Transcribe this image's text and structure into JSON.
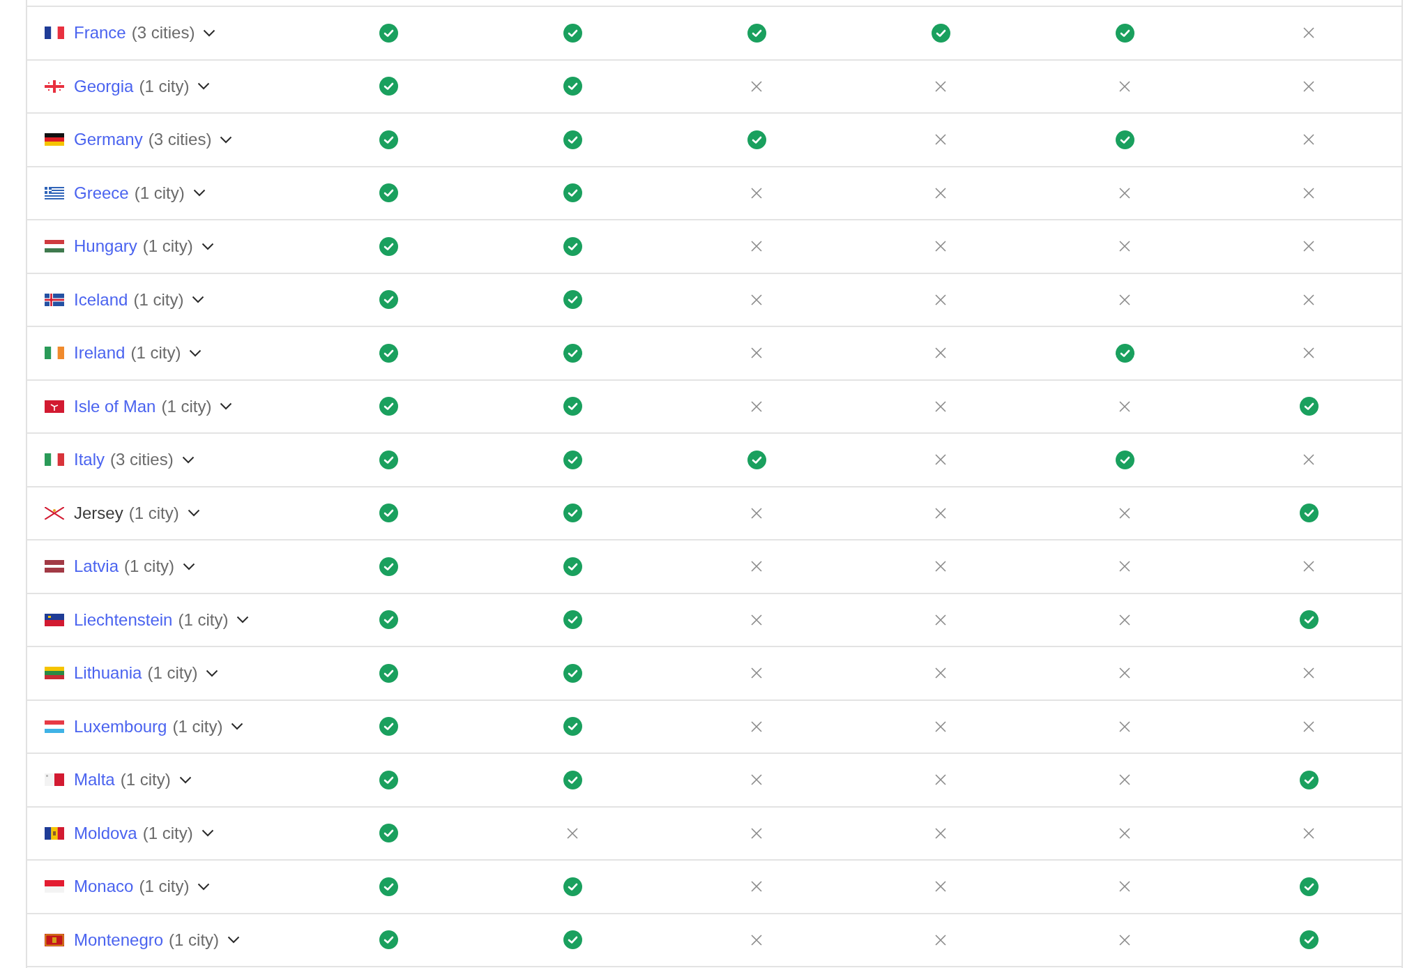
{
  "rows": [
    {
      "kind": "fr",
      "name": "France",
      "link": true,
      "count": "(3 cities)",
      "checks": [
        true,
        true,
        true,
        true,
        true,
        false
      ]
    },
    {
      "kind": "ge",
      "name": "Georgia",
      "link": true,
      "count": "(1 city)",
      "checks": [
        true,
        true,
        false,
        false,
        false,
        false
      ]
    },
    {
      "kind": "de",
      "name": "Germany",
      "link": true,
      "count": "(3 cities)",
      "checks": [
        true,
        true,
        true,
        false,
        true,
        false
      ]
    },
    {
      "kind": "gr",
      "name": "Greece",
      "link": true,
      "count": "(1 city)",
      "checks": [
        true,
        true,
        false,
        false,
        false,
        false
      ]
    },
    {
      "kind": "hu",
      "name": "Hungary",
      "link": true,
      "count": "(1 city)",
      "checks": [
        true,
        true,
        false,
        false,
        false,
        false
      ]
    },
    {
      "kind": "is",
      "name": "Iceland",
      "link": true,
      "count": "(1 city)",
      "checks": [
        true,
        true,
        false,
        false,
        false,
        false
      ]
    },
    {
      "kind": "ie",
      "name": "Ireland",
      "link": true,
      "count": "(1 city)",
      "checks": [
        true,
        true,
        false,
        false,
        true,
        false
      ]
    },
    {
      "kind": "im",
      "name": "Isle of Man",
      "link": true,
      "count": "(1 city)",
      "checks": [
        true,
        true,
        false,
        false,
        false,
        true
      ]
    },
    {
      "kind": "it",
      "name": "Italy",
      "link": true,
      "count": "(3 cities)",
      "checks": [
        true,
        true,
        true,
        false,
        true,
        false
      ]
    },
    {
      "kind": "je",
      "name": "Jersey",
      "link": false,
      "count": "(1 city)",
      "checks": [
        true,
        true,
        false,
        false,
        false,
        true
      ]
    },
    {
      "kind": "lv",
      "name": "Latvia",
      "link": true,
      "count": "(1 city)",
      "checks": [
        true,
        true,
        false,
        false,
        false,
        false
      ]
    },
    {
      "kind": "li",
      "name": "Liechtenstein",
      "link": true,
      "count": "(1 city)",
      "checks": [
        true,
        true,
        false,
        false,
        false,
        true
      ]
    },
    {
      "kind": "lt",
      "name": "Lithuania",
      "link": true,
      "count": "(1 city)",
      "checks": [
        true,
        true,
        false,
        false,
        false,
        false
      ]
    },
    {
      "kind": "lu",
      "name": "Luxembourg",
      "link": true,
      "count": "(1 city)",
      "checks": [
        true,
        true,
        false,
        false,
        false,
        false
      ]
    },
    {
      "kind": "mt",
      "name": "Malta",
      "link": true,
      "count": "(1 city)",
      "checks": [
        true,
        true,
        false,
        false,
        false,
        true
      ]
    },
    {
      "kind": "md",
      "name": "Moldova",
      "link": true,
      "count": "(1 city)",
      "checks": [
        true,
        false,
        false,
        false,
        false,
        false
      ]
    },
    {
      "kind": "mc",
      "name": "Monaco",
      "link": true,
      "count": "(1 city)",
      "checks": [
        true,
        true,
        false,
        false,
        false,
        true
      ]
    },
    {
      "kind": "me",
      "name": "Montenegro",
      "link": true,
      "count": "(1 city)",
      "checks": [
        true,
        true,
        false,
        false,
        false,
        true
      ]
    }
  ]
}
